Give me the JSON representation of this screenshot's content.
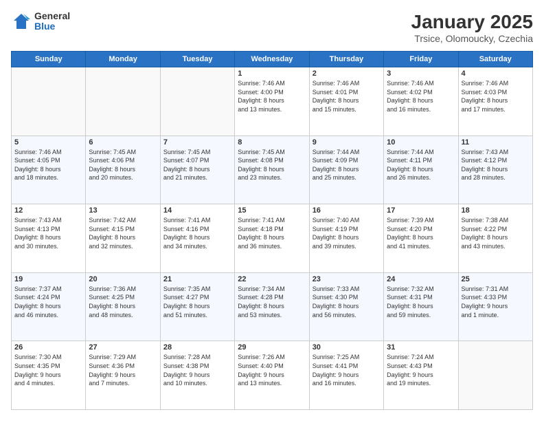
{
  "header": {
    "logo_general": "General",
    "logo_blue": "Blue",
    "title": "January 2025",
    "subtitle": "Trsice, Olomoucky, Czechia"
  },
  "weekdays": [
    "Sunday",
    "Monday",
    "Tuesday",
    "Wednesday",
    "Thursday",
    "Friday",
    "Saturday"
  ],
  "weeks": [
    [
      {
        "day": "",
        "text": ""
      },
      {
        "day": "",
        "text": ""
      },
      {
        "day": "",
        "text": ""
      },
      {
        "day": "1",
        "text": "Sunrise: 7:46 AM\nSunset: 4:00 PM\nDaylight: 8 hours\nand 13 minutes."
      },
      {
        "day": "2",
        "text": "Sunrise: 7:46 AM\nSunset: 4:01 PM\nDaylight: 8 hours\nand 15 minutes."
      },
      {
        "day": "3",
        "text": "Sunrise: 7:46 AM\nSunset: 4:02 PM\nDaylight: 8 hours\nand 16 minutes."
      },
      {
        "day": "4",
        "text": "Sunrise: 7:46 AM\nSunset: 4:03 PM\nDaylight: 8 hours\nand 17 minutes."
      }
    ],
    [
      {
        "day": "5",
        "text": "Sunrise: 7:46 AM\nSunset: 4:05 PM\nDaylight: 8 hours\nand 18 minutes."
      },
      {
        "day": "6",
        "text": "Sunrise: 7:45 AM\nSunset: 4:06 PM\nDaylight: 8 hours\nand 20 minutes."
      },
      {
        "day": "7",
        "text": "Sunrise: 7:45 AM\nSunset: 4:07 PM\nDaylight: 8 hours\nand 21 minutes."
      },
      {
        "day": "8",
        "text": "Sunrise: 7:45 AM\nSunset: 4:08 PM\nDaylight: 8 hours\nand 23 minutes."
      },
      {
        "day": "9",
        "text": "Sunrise: 7:44 AM\nSunset: 4:09 PM\nDaylight: 8 hours\nand 25 minutes."
      },
      {
        "day": "10",
        "text": "Sunrise: 7:44 AM\nSunset: 4:11 PM\nDaylight: 8 hours\nand 26 minutes."
      },
      {
        "day": "11",
        "text": "Sunrise: 7:43 AM\nSunset: 4:12 PM\nDaylight: 8 hours\nand 28 minutes."
      }
    ],
    [
      {
        "day": "12",
        "text": "Sunrise: 7:43 AM\nSunset: 4:13 PM\nDaylight: 8 hours\nand 30 minutes."
      },
      {
        "day": "13",
        "text": "Sunrise: 7:42 AM\nSunset: 4:15 PM\nDaylight: 8 hours\nand 32 minutes."
      },
      {
        "day": "14",
        "text": "Sunrise: 7:41 AM\nSunset: 4:16 PM\nDaylight: 8 hours\nand 34 minutes."
      },
      {
        "day": "15",
        "text": "Sunrise: 7:41 AM\nSunset: 4:18 PM\nDaylight: 8 hours\nand 36 minutes."
      },
      {
        "day": "16",
        "text": "Sunrise: 7:40 AM\nSunset: 4:19 PM\nDaylight: 8 hours\nand 39 minutes."
      },
      {
        "day": "17",
        "text": "Sunrise: 7:39 AM\nSunset: 4:20 PM\nDaylight: 8 hours\nand 41 minutes."
      },
      {
        "day": "18",
        "text": "Sunrise: 7:38 AM\nSunset: 4:22 PM\nDaylight: 8 hours\nand 43 minutes."
      }
    ],
    [
      {
        "day": "19",
        "text": "Sunrise: 7:37 AM\nSunset: 4:24 PM\nDaylight: 8 hours\nand 46 minutes."
      },
      {
        "day": "20",
        "text": "Sunrise: 7:36 AM\nSunset: 4:25 PM\nDaylight: 8 hours\nand 48 minutes."
      },
      {
        "day": "21",
        "text": "Sunrise: 7:35 AM\nSunset: 4:27 PM\nDaylight: 8 hours\nand 51 minutes."
      },
      {
        "day": "22",
        "text": "Sunrise: 7:34 AM\nSunset: 4:28 PM\nDaylight: 8 hours\nand 53 minutes."
      },
      {
        "day": "23",
        "text": "Sunrise: 7:33 AM\nSunset: 4:30 PM\nDaylight: 8 hours\nand 56 minutes."
      },
      {
        "day": "24",
        "text": "Sunrise: 7:32 AM\nSunset: 4:31 PM\nDaylight: 8 hours\nand 59 minutes."
      },
      {
        "day": "25",
        "text": "Sunrise: 7:31 AM\nSunset: 4:33 PM\nDaylight: 9 hours\nand 1 minute."
      }
    ],
    [
      {
        "day": "26",
        "text": "Sunrise: 7:30 AM\nSunset: 4:35 PM\nDaylight: 9 hours\nand 4 minutes."
      },
      {
        "day": "27",
        "text": "Sunrise: 7:29 AM\nSunset: 4:36 PM\nDaylight: 9 hours\nand 7 minutes."
      },
      {
        "day": "28",
        "text": "Sunrise: 7:28 AM\nSunset: 4:38 PM\nDaylight: 9 hours\nand 10 minutes."
      },
      {
        "day": "29",
        "text": "Sunrise: 7:26 AM\nSunset: 4:40 PM\nDaylight: 9 hours\nand 13 minutes."
      },
      {
        "day": "30",
        "text": "Sunrise: 7:25 AM\nSunset: 4:41 PM\nDaylight: 9 hours\nand 16 minutes."
      },
      {
        "day": "31",
        "text": "Sunrise: 7:24 AM\nSunset: 4:43 PM\nDaylight: 9 hours\nand 19 minutes."
      },
      {
        "day": "",
        "text": ""
      }
    ]
  ]
}
